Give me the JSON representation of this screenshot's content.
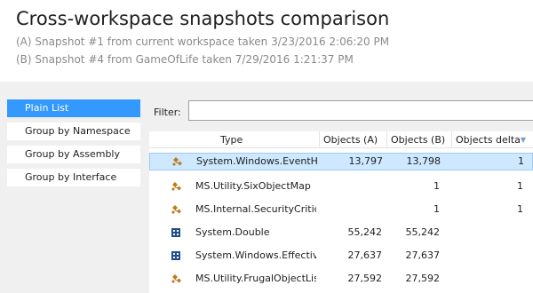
{
  "header": {
    "title": "Cross-workspace snapshots comparison",
    "snapshot_a": "(A) Snapshot #1 from current workspace taken 3/23/2016 2:06:20 PM",
    "snapshot_b": "(B) Snapshot #4 from GameOfLife taken 7/29/2016 1:21:37 PM"
  },
  "nav": {
    "items": [
      {
        "label": "Plain List",
        "selected": true
      },
      {
        "label": "Group by Namespace",
        "selected": false
      },
      {
        "label": "Group by Assembly",
        "selected": false
      },
      {
        "label": "Group by Interface",
        "selected": false
      }
    ]
  },
  "filter": {
    "label": "Filter:",
    "value": ""
  },
  "grid": {
    "columns": {
      "type": "Type",
      "objects_a": "Objects (A)",
      "objects_b": "Objects (B)",
      "objects_delta": "Objects delta"
    },
    "sort": {
      "column": "objects_delta",
      "direction": "descending",
      "arrow": "▼"
    },
    "rows": [
      {
        "icon": "class-icon",
        "type": "System.Windows.EventHa",
        "a": "13,797",
        "b": "13,798",
        "delta": "1",
        "selected": true
      },
      {
        "icon": "class-icon",
        "type": "MS.Utility.SixObjectMap",
        "a": "",
        "b": "1",
        "delta": "1",
        "selected": false
      },
      {
        "icon": "class-icon",
        "type": "MS.Internal.SecurityCritica",
        "a": "",
        "b": "1",
        "delta": "1",
        "selected": false
      },
      {
        "icon": "struct-icon",
        "type": "System.Double",
        "a": "55,242",
        "b": "55,242",
        "delta": "",
        "selected": false
      },
      {
        "icon": "struct-icon",
        "type": "System.Windows.Effective",
        "a": "27,637",
        "b": "27,637",
        "delta": "",
        "selected": false
      },
      {
        "icon": "class-icon",
        "type": "MS.Utility.FrugalObjectLis",
        "a": "27,592",
        "b": "27,592",
        "delta": "",
        "selected": false
      }
    ]
  },
  "colors": {
    "selection": "#3399ff",
    "row_highlight": "#cde8ff",
    "panel_bg": "#f0f0f0",
    "class_icon": "#c07a1e",
    "struct_icon": "#1f4e8a"
  }
}
